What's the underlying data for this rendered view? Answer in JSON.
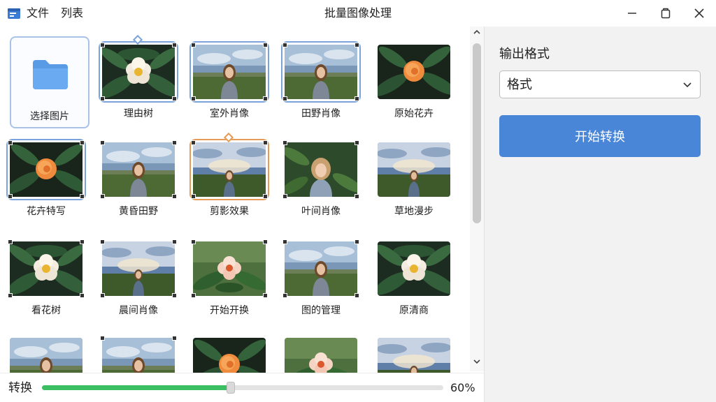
{
  "titlebar": {
    "menu": [
      "文件",
      "列表"
    ],
    "title": "批量图像处理"
  },
  "gallery": {
    "folder_label": "选择图片",
    "tiles": [
      {
        "caption": "理由树",
        "kind": "flower-white",
        "selected": "blue",
        "diamond": true,
        "corners": true
      },
      {
        "caption": "室外肖像",
        "kind": "girl",
        "selected": "blue",
        "diamond": false,
        "corners": true
      },
      {
        "caption": "田野肖像",
        "kind": "girl",
        "selected": "blue",
        "diamond": false,
        "corners": true
      },
      {
        "caption": "原始花卉",
        "kind": "flower-orange",
        "selected": "",
        "diamond": false,
        "corners": false
      },
      {
        "caption": "花卉特写",
        "kind": "flower-orange",
        "selected": "blue",
        "diamond": false,
        "corners": true
      },
      {
        "caption": "黄昏田野",
        "kind": "girl",
        "selected": "",
        "diamond": false,
        "corners": true
      },
      {
        "caption": "剪影效果",
        "kind": "girl-field",
        "selected": "orange",
        "diamond": true,
        "corners": true
      },
      {
        "caption": "叶间肖像",
        "kind": "girl-leaf",
        "selected": "",
        "diamond": false,
        "corners": true
      },
      {
        "caption": "草地漫步",
        "kind": "girl-field",
        "selected": "",
        "diamond": false,
        "corners": false
      },
      {
        "caption": "看花树",
        "kind": "flower-white",
        "selected": "",
        "diamond": false,
        "corners": true
      },
      {
        "caption": "晨间肖像",
        "kind": "girl-field",
        "selected": "",
        "diamond": false,
        "corners": true
      },
      {
        "caption": "开始开换",
        "kind": "flower-pink",
        "selected": "",
        "diamond": false,
        "corners": true
      },
      {
        "caption": "图的管理",
        "kind": "girl",
        "selected": "",
        "diamond": false,
        "corners": true
      },
      {
        "caption": "原清商",
        "kind": "flower-white",
        "selected": "",
        "diamond": false,
        "corners": false
      },
      {
        "caption": "",
        "kind": "girl",
        "selected": "",
        "diamond": false,
        "corners": false
      },
      {
        "caption": "",
        "kind": "girl",
        "selected": "",
        "diamond": false,
        "corners": true
      },
      {
        "caption": "",
        "kind": "flower-orange",
        "selected": "",
        "diamond": false,
        "corners": false
      },
      {
        "caption": "",
        "kind": "flower-pink",
        "selected": "",
        "diamond": false,
        "corners": false
      },
      {
        "caption": "",
        "kind": "girl-field",
        "selected": "",
        "diamond": false,
        "corners": false
      }
    ]
  },
  "status": {
    "label": "转换",
    "progress": 0.6,
    "progress_text": "60%"
  },
  "panel": {
    "format_label": "输出格式",
    "format_value": "格式",
    "start_label": "开始转换"
  },
  "colors": {
    "accent": "#4a86d8",
    "progress": "#3cbf63",
    "select_blue": "#7aa3dc",
    "select_orange": "#e59a55"
  },
  "icons": [
    "app-icon",
    "folder-icon",
    "minimize-icon",
    "maximize-icon",
    "close-icon",
    "chevron-down-icon",
    "scroll-up-icon",
    "scroll-down-icon"
  ]
}
